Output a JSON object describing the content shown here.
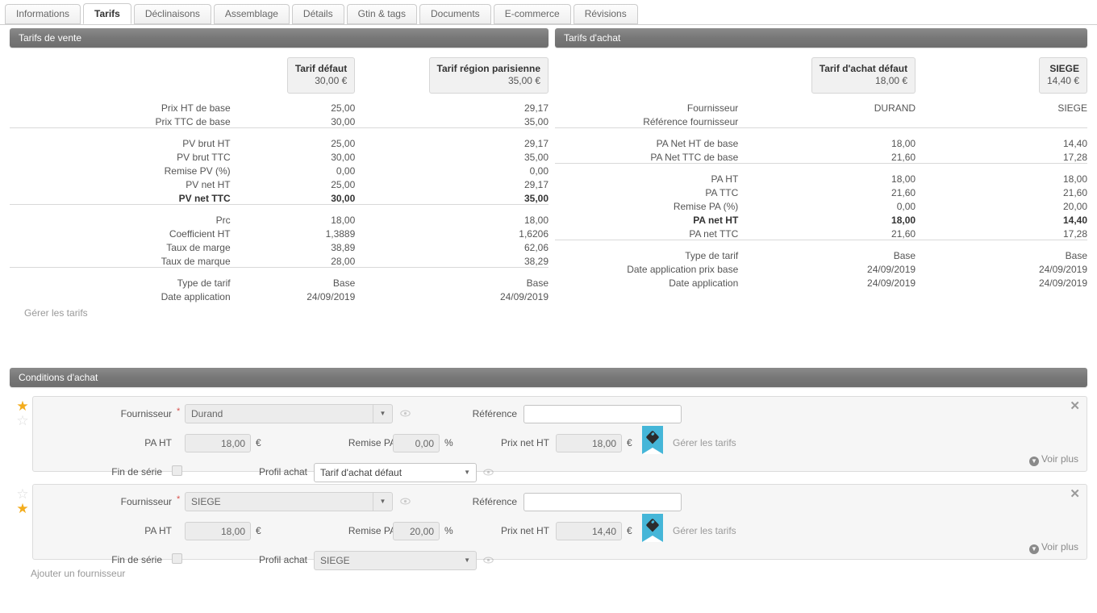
{
  "tabs": [
    {
      "label": "Informations",
      "active": false
    },
    {
      "label": "Tarifs",
      "active": true
    },
    {
      "label": "Déclinaisons",
      "active": false
    },
    {
      "label": "Assemblage",
      "active": false
    },
    {
      "label": "Détails",
      "active": false
    },
    {
      "label": "Gtin & tags",
      "active": false
    },
    {
      "label": "Documents",
      "active": false
    },
    {
      "label": "E-commerce",
      "active": false
    },
    {
      "label": "Révisions",
      "active": false
    }
  ],
  "sales": {
    "section_title": "Tarifs de vente",
    "columns": [
      {
        "name": "Tarif défaut",
        "price": "30,00 €"
      },
      {
        "name": "Tarif région parisienne",
        "price": "35,00 €"
      }
    ],
    "group1": [
      {
        "label": "Prix HT de base",
        "values": [
          "25,00",
          "29,17"
        ],
        "bold": false
      },
      {
        "label": "Prix TTC de base",
        "values": [
          "30,00",
          "35,00"
        ],
        "bold": false
      }
    ],
    "group2": [
      {
        "label": "PV brut HT",
        "values": [
          "25,00",
          "29,17"
        ],
        "bold": false
      },
      {
        "label": "PV brut TTC",
        "values": [
          "30,00",
          "35,00"
        ],
        "bold": false
      },
      {
        "label": "Remise PV (%)",
        "values": [
          "0,00",
          "0,00"
        ],
        "bold": false
      },
      {
        "label": "PV net HT",
        "values": [
          "25,00",
          "29,17"
        ],
        "bold": false
      },
      {
        "label": "PV net TTC",
        "values": [
          "30,00",
          "35,00"
        ],
        "bold": true
      }
    ],
    "group3": [
      {
        "label": "Prc",
        "values": [
          "18,00",
          "18,00"
        ],
        "bold": false
      },
      {
        "label": "Coefficient HT",
        "values": [
          "1,3889",
          "1,6206"
        ],
        "bold": false
      },
      {
        "label": "Taux de marge",
        "values": [
          "38,89",
          "62,06"
        ],
        "bold": false
      },
      {
        "label": "Taux de marque",
        "values": [
          "28,00",
          "38,29"
        ],
        "bold": false
      }
    ],
    "group4": [
      {
        "label": "Type de tarif",
        "values": [
          "Base",
          "Base"
        ],
        "bold": false
      },
      {
        "label": "Date application",
        "values": [
          "24/09/2019",
          "24/09/2019"
        ],
        "bold": false
      }
    ],
    "manage_link": "Gérer les tarifs"
  },
  "purchase": {
    "section_title": "Tarifs d'achat",
    "columns": [
      {
        "name": "Tarif d'achat défaut",
        "price": "18,00 €"
      },
      {
        "name": "SIEGE",
        "price": "14,40 €"
      }
    ],
    "group0": [
      {
        "label": "Fournisseur",
        "values": [
          "DURAND",
          "SIEGE"
        ],
        "bold": false
      },
      {
        "label": "Référence fournisseur",
        "values": [
          "",
          ""
        ],
        "bold": false
      }
    ],
    "group1": [
      {
        "label": "PA Net HT de base",
        "values": [
          "18,00",
          "14,40"
        ],
        "bold": false
      },
      {
        "label": "PA Net TTC de base",
        "values": [
          "21,60",
          "17,28"
        ],
        "bold": false
      }
    ],
    "group2": [
      {
        "label": "PA HT",
        "values": [
          "18,00",
          "18,00"
        ],
        "bold": false
      },
      {
        "label": "PA TTC",
        "values": [
          "21,60",
          "21,60"
        ],
        "bold": false
      },
      {
        "label": "Remise PA (%)",
        "values": [
          "0,00",
          "20,00"
        ],
        "bold": false
      },
      {
        "label": "PA net HT",
        "values": [
          "18,00",
          "14,40"
        ],
        "bold": true
      },
      {
        "label": "PA net TTC",
        "values": [
          "21,60",
          "17,28"
        ],
        "bold": false
      }
    ],
    "group3": [
      {
        "label": "Type de tarif",
        "values": [
          "Base",
          "Base"
        ],
        "bold": false
      },
      {
        "label": "Date application prix base",
        "values": [
          "24/09/2019",
          "24/09/2019"
        ],
        "bold": false
      },
      {
        "label": "Date application",
        "values": [
          "24/09/2019",
          "24/09/2019"
        ],
        "bold": false
      }
    ]
  },
  "conditions": {
    "section_title": "Conditions d'achat",
    "labels": {
      "fournisseur": "Fournisseur",
      "reference": "Référence",
      "pa_ht": "PA HT",
      "remise_pa": "Remise PA",
      "prix_net_ht": "Prix net HT",
      "fin_de_serie": "Fin de série",
      "profil_achat": "Profil achat",
      "manage": "Gérer les tarifs",
      "voir_plus": "Voir plus",
      "euro": "€",
      "percent": "%",
      "required_mark": "*"
    },
    "rows": [
      {
        "fournisseur": "Durand",
        "reference": "",
        "pa_ht": "18,00",
        "remise_pa": "0,00",
        "prix_net_ht": "18,00",
        "fin_de_serie_checked": false,
        "profil_achat": "Tarif d'achat défaut",
        "profil_disabled": false,
        "star_top_filled": true,
        "star_bottom_filled": false
      },
      {
        "fournisseur": "SIEGE",
        "reference": "",
        "pa_ht": "18,00",
        "remise_pa": "20,00",
        "prix_net_ht": "14,40",
        "fin_de_serie_checked": false,
        "profil_achat": "SIEGE",
        "profil_disabled": true,
        "star_top_filled": false,
        "star_bottom_filled": true
      }
    ],
    "add_supplier": "Ajouter un fournisseur"
  },
  "colors": {
    "section_header": "#777777",
    "accent_ribbon": "#45b6d8",
    "star_filled": "#f3ac1c",
    "required": "#d9534f"
  }
}
